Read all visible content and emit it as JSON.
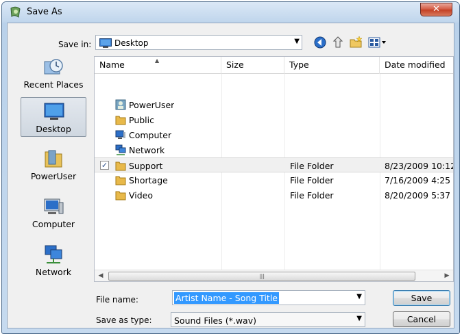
{
  "window": {
    "title": "Save As",
    "close_glyph": "✕"
  },
  "toolbar": {
    "save_in_label": "Save in:",
    "save_in_value": "Desktop",
    "icons": [
      "back-icon",
      "up-folder-icon",
      "new-folder-icon",
      "views-menu-icon"
    ]
  },
  "places": [
    {
      "label": "Recent Places",
      "icon": "recent-places-icon",
      "selected": false
    },
    {
      "label": "Desktop",
      "icon": "desktop-icon",
      "selected": true
    },
    {
      "label": "PowerUser",
      "icon": "user-folder-icon",
      "selected": false
    },
    {
      "label": "Computer",
      "icon": "computer-icon",
      "selected": false
    },
    {
      "label": "Network",
      "icon": "network-icon",
      "selected": false
    }
  ],
  "columns": [
    "Name",
    "Size",
    "Type",
    "Date modified"
  ],
  "rows": [
    {
      "name": "PowerUser",
      "icon": "user-icon",
      "size": "",
      "type": "",
      "date": "",
      "checked": false
    },
    {
      "name": "Public",
      "icon": "folder-icon",
      "size": "",
      "type": "",
      "date": "",
      "checked": false
    },
    {
      "name": "Computer",
      "icon": "computer-icon",
      "size": "",
      "type": "",
      "date": "",
      "checked": false
    },
    {
      "name": "Network",
      "icon": "network-icon",
      "size": "",
      "type": "",
      "date": "",
      "checked": false
    },
    {
      "name": "Support",
      "icon": "folder-icon",
      "size": "",
      "type": "File Folder",
      "date": "8/23/2009 10:12",
      "checked": true
    },
    {
      "name": "Shortage",
      "icon": "folder-icon",
      "size": "",
      "type": "File Folder",
      "date": "7/16/2009 4:25 P",
      "checked": false
    },
    {
      "name": "Video",
      "icon": "folder-icon",
      "size": "",
      "type": "File Folder",
      "date": "8/20/2009 5:37 P",
      "checked": false
    }
  ],
  "file_name": {
    "label": "File name:",
    "value": "Artist Name - Song Title"
  },
  "save_as_type": {
    "label": "Save as type:",
    "value": "Sound Files (*.wav)"
  },
  "buttons": {
    "save": "Save",
    "cancel": "Cancel"
  },
  "colors": {
    "title_gradient": "#bfd5ec",
    "close_button": "#c23e22",
    "selection": "#3399ff",
    "folder": "#e8b94a"
  }
}
